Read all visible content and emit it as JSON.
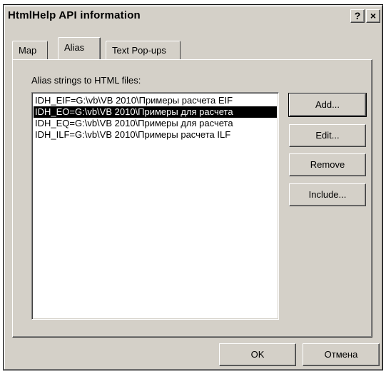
{
  "window": {
    "title": "HtmlHelp API information"
  },
  "titlebar": {
    "help_label": "?",
    "close_label": "×"
  },
  "tabs": [
    {
      "label": "Map",
      "active": false
    },
    {
      "label": "Alias",
      "active": true
    },
    {
      "label": "Text Pop-ups",
      "active": false
    }
  ],
  "alias_panel": {
    "list_label": "Alias strings to HTML files:",
    "items": [
      {
        "text": "IDH_EIF=G:\\vb\\VB 2010\\Примеры расчета EIF",
        "selected": false
      },
      {
        "text": "IDH_EO=G:\\vb\\VB 2010\\Примеры для расчета",
        "selected": true
      },
      {
        "text": "IDH_EQ=G:\\vb\\VB 2010\\Примеры для расчета",
        "selected": false
      },
      {
        "text": "IDH_ILF=G:\\vb\\VB 2010\\Примеры расчета ILF",
        "selected": false
      }
    ],
    "buttons": {
      "add": "Add...",
      "edit": "Edit...",
      "remove": "Remove",
      "include": "Include..."
    }
  },
  "footer": {
    "ok": "OK",
    "cancel": "Отмена"
  },
  "colors": {
    "face": "#d4d0c8",
    "selection_bg": "#000000",
    "selection_fg": "#ffffff"
  }
}
